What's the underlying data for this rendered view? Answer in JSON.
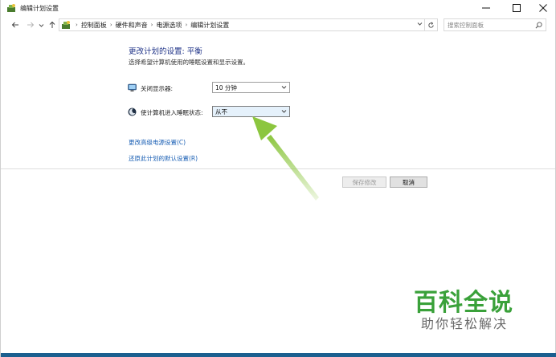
{
  "window": {
    "title": "编辑计划设置",
    "icon": "power-options-icon",
    "minimize_icon": "minimize-icon",
    "maximize_icon": "maximize-icon",
    "close_icon": "close-icon"
  },
  "address_bar": {
    "back_icon": "arrow-left-icon",
    "forward_icon": "arrow-right-icon",
    "recent_icon": "chevron-down-icon",
    "up_icon": "arrow-up-icon",
    "breadcrumbs": [
      "控制面板",
      "硬件和声音",
      "电源选项",
      "编辑计划设置"
    ],
    "refresh_icon": "refresh-icon",
    "search_placeholder": "搜索控制面板"
  },
  "main": {
    "heading": "更改计划的设置: 平衡",
    "subheading": "选择希望计算机使用的睡眠设置和显示设置。",
    "settings": [
      {
        "label": "关闭显示器:",
        "value": "10 分钟",
        "icon": "monitor-icon"
      },
      {
        "label": "使计算机进入睡眠状态:",
        "value": "从不",
        "icon": "moon-icon"
      }
    ],
    "links": [
      "更改高级电源设置(C)",
      "还原此计划的默认设置(R)"
    ],
    "save_label": "保存修改",
    "cancel_label": "取消"
  },
  "annotation": {
    "color": "#8cc63f"
  },
  "watermark": {
    "title": "百科全说",
    "subtitle": "助你轻松解决",
    "color": "#3aa13a"
  }
}
